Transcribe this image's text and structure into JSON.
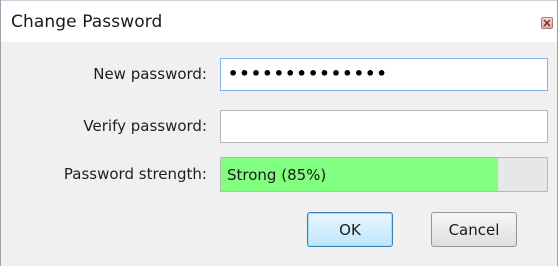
{
  "window": {
    "title": "Change Password"
  },
  "form": {
    "new_password_label": "New password:",
    "new_password_value": "••••••••••••••",
    "verify_password_label": "Verify password:",
    "verify_password_value": "",
    "strength_label": "Password strength:",
    "strength_text": "Strong (85%)",
    "strength_fraction": 0.85,
    "strength_color": "#80ff80"
  },
  "buttons": {
    "ok_label": "OK",
    "cancel_label": "Cancel"
  },
  "icons": {
    "close": "close-icon"
  }
}
